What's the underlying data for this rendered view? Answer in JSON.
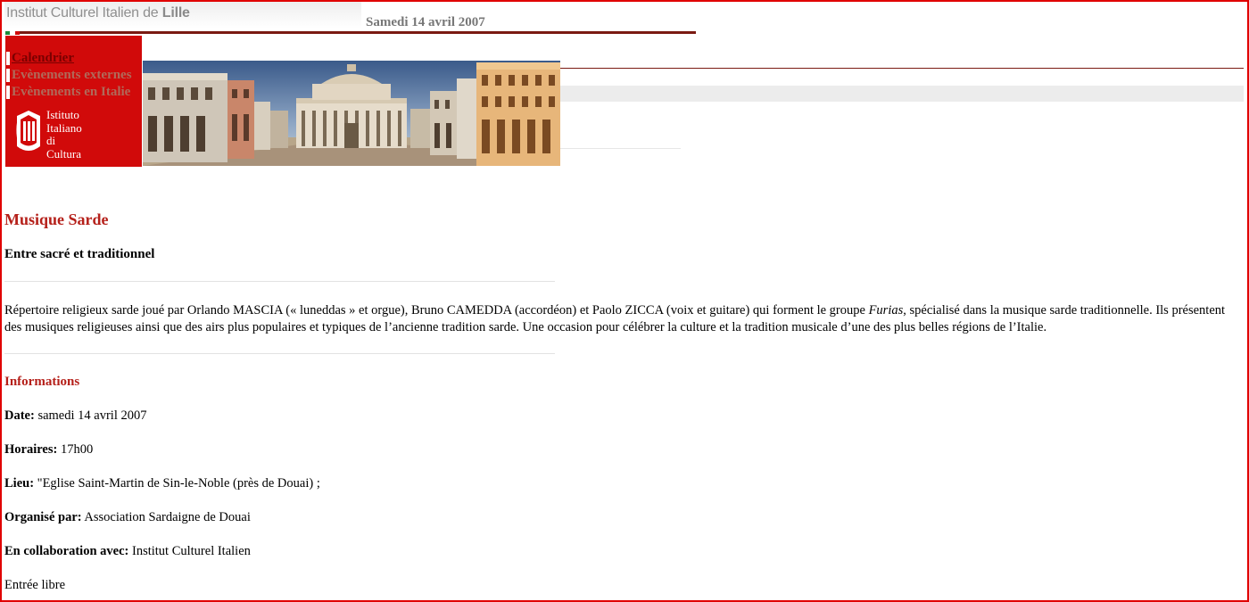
{
  "header": {
    "site_title_prefix": "Institut Culturel Italien de ",
    "site_title_city": "Lille",
    "date": "Samedi 14 avril 2007"
  },
  "sidebar": {
    "nav": [
      {
        "label": "Calendrier"
      },
      {
        "label": "Evènements externes"
      },
      {
        "label": "Evènements en Italie"
      }
    ],
    "logo_lines": [
      "Istituto",
      "Italiano",
      "di",
      "Cultura"
    ]
  },
  "colors": {
    "accent_red": "#d10a0a",
    "title_red": "#b5201a",
    "rule_brown": "#7a1a12",
    "frame_red": "#e00000"
  },
  "event": {
    "title": "Musique Sarde",
    "subtitle": "Entre sacré et traditionnel",
    "description_part1": "Répertoire religieux sarde joué par Orlando MASCIA (« luneddas »  et orgue), Bruno CAMEDDA (accordéon) et Paolo ZICCA (voix et guitare) qui forment le groupe ",
    "description_italic": "Furias",
    "description_part2": ", spécialisé dans la musique sarde traditionnelle. Ils présentent des musiques religieuses ainsi que des airs plus populaires et typiques de l’ancienne tradition sarde. Une occasion pour célébrer la culture et la tradition musicale d’une des plus belles régions de l’Italie."
  },
  "info": {
    "heading": "Informations",
    "rows": [
      {
        "label": "Date:",
        "value": " samedi 14 avril 2007"
      },
      {
        "label": "Horaires:",
        "value": " 17h00"
      },
      {
        "label": "Lieu:",
        "value": " \"Eglise Saint-Martin de Sin-le-Noble (près de Douai) ;"
      },
      {
        "label": "Organisé par:",
        "value": " Association Sardaigne de Douai"
      },
      {
        "label": "En collaboration avec:",
        "value": " Institut Culturel Italien"
      }
    ],
    "entry": "Entrée libre"
  }
}
